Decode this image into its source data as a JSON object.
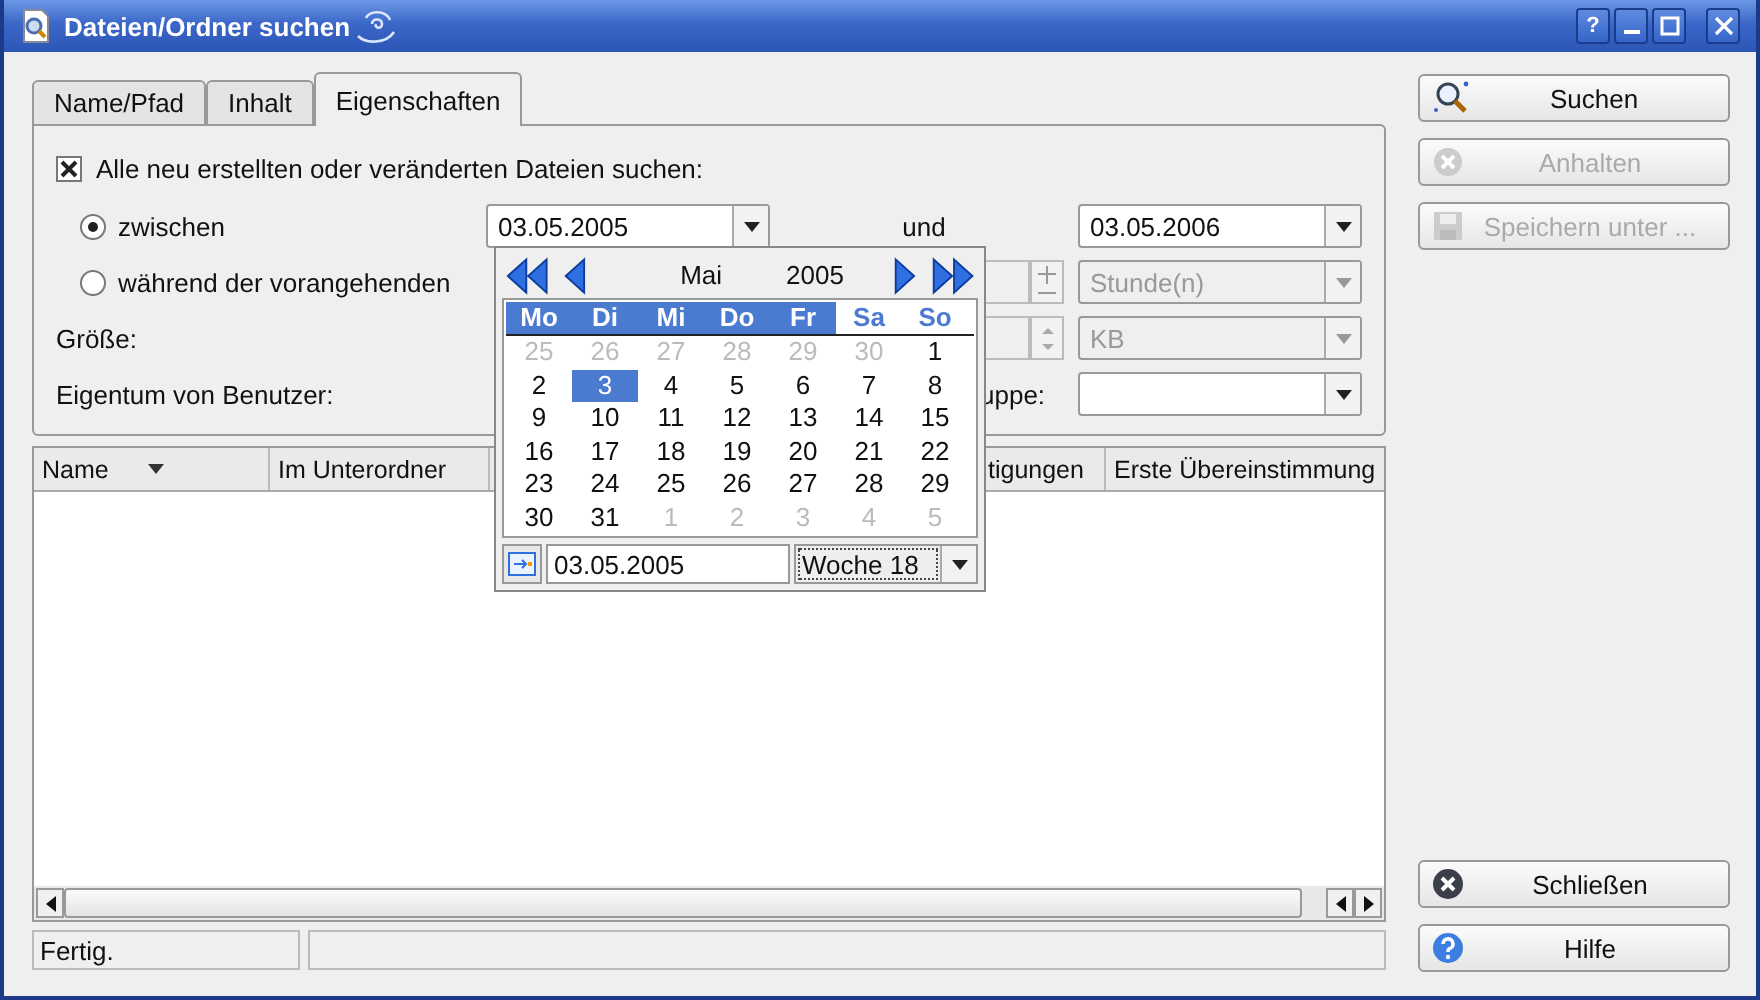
{
  "window": {
    "title": "Dateien/Ordner suchen",
    "help_button": "?"
  },
  "tabs": [
    {
      "label": "Name/Pfad",
      "selected": false
    },
    {
      "label": "Inhalt",
      "selected": false
    },
    {
      "label": "Eigenschaften",
      "selected": true
    }
  ],
  "properties": {
    "checkbox": {
      "label": "Alle neu erstellten oder veränderten Dateien suchen:",
      "checked": true
    },
    "radios": [
      {
        "label": "zwischen",
        "selected": true
      },
      {
        "label": "während der vorangehenden",
        "selected": false
      }
    ],
    "from_date": "03.05.2005",
    "conjunction": "und",
    "to_date": "03.05.2006",
    "period_unit": {
      "value": "Stunde(n)",
      "disabled": true
    },
    "size_label": "Größe:",
    "size_unit": {
      "value": "KB",
      "disabled": true
    },
    "owner_label": "Eigentum von Benutzer:",
    "group_label": "uppe:"
  },
  "table": {
    "columns": [
      {
        "label": "Name",
        "sorted": true
      },
      {
        "label": "Im Unterordner",
        "sorted": false
      },
      {
        "label": "tigungen",
        "sorted": false
      },
      {
        "label": "Erste Übereinstimmung",
        "sorted": false
      }
    ]
  },
  "status_bar": {
    "message": "Fertig."
  },
  "buttons": [
    {
      "label": "Suchen",
      "disabled": false,
      "kind": "search"
    },
    {
      "label": "Anhalten",
      "disabled": true,
      "kind": "stop"
    },
    {
      "label": "Speichern unter ...",
      "disabled": true,
      "kind": "save"
    }
  ],
  "bottom_buttons": [
    {
      "label": "Schließen",
      "kind": "close"
    },
    {
      "label": "Hilfe",
      "kind": "help"
    }
  ],
  "calendar": {
    "month": "Mai",
    "year": "2005",
    "weekdays": [
      {
        "label": "Mo",
        "weekend": false
      },
      {
        "label": "Di",
        "weekend": false
      },
      {
        "label": "Mi",
        "weekend": false
      },
      {
        "label": "Do",
        "weekend": false
      },
      {
        "label": "Fr",
        "weekend": false
      },
      {
        "label": "Sa",
        "weekend": true
      },
      {
        "label": "So",
        "weekend": true
      }
    ],
    "weeks": [
      [
        {
          "day": "25",
          "other_month": true,
          "selected": false
        },
        {
          "day": "26",
          "other_month": true,
          "selected": false
        },
        {
          "day": "27",
          "other_month": true,
          "selected": false
        },
        {
          "day": "28",
          "other_month": true,
          "selected": false
        },
        {
          "day": "29",
          "other_month": true,
          "selected": false
        },
        {
          "day": "30",
          "other_month": true,
          "selected": false
        },
        {
          "day": "1",
          "other_month": false,
          "selected": false
        }
      ],
      [
        {
          "day": "2",
          "other_month": false,
          "selected": false
        },
        {
          "day": "3",
          "other_month": false,
          "selected": true
        },
        {
          "day": "4",
          "other_month": false,
          "selected": false
        },
        {
          "day": "5",
          "other_month": false,
          "selected": false
        },
        {
          "day": "6",
          "other_month": false,
          "selected": false
        },
        {
          "day": "7",
          "other_month": false,
          "selected": false
        },
        {
          "day": "8",
          "other_month": false,
          "selected": false
        }
      ],
      [
        {
          "day": "9",
          "other_month": false,
          "selected": false
        },
        {
          "day": "10",
          "other_month": false,
          "selected": false
        },
        {
          "day": "11",
          "other_month": false,
          "selected": false
        },
        {
          "day": "12",
          "other_month": false,
          "selected": false
        },
        {
          "day": "13",
          "other_month": false,
          "selected": false
        },
        {
          "day": "14",
          "other_month": false,
          "selected": false
        },
        {
          "day": "15",
          "other_month": false,
          "selected": false
        }
      ],
      [
        {
          "day": "16",
          "other_month": false,
          "selected": false
        },
        {
          "day": "17",
          "other_month": false,
          "selected": false
        },
        {
          "day": "18",
          "other_month": false,
          "selected": false
        },
        {
          "day": "19",
          "other_month": false,
          "selected": false
        },
        {
          "day": "20",
          "other_month": false,
          "selected": false
        },
        {
          "day": "21",
          "other_month": false,
          "selected": false
        },
        {
          "day": "22",
          "other_month": false,
          "selected": false
        }
      ],
      [
        {
          "day": "23",
          "other_month": false,
          "selected": false
        },
        {
          "day": "24",
          "other_month": false,
          "selected": false
        },
        {
          "day": "25",
          "other_month": false,
          "selected": false
        },
        {
          "day": "26",
          "other_month": false,
          "selected": false
        },
        {
          "day": "27",
          "other_month": false,
          "selected": false
        },
        {
          "day": "28",
          "other_month": false,
          "selected": false
        },
        {
          "day": "29",
          "other_month": false,
          "selected": false
        }
      ],
      [
        {
          "day": "30",
          "other_month": false,
          "selected": false
        },
        {
          "day": "31",
          "other_month": false,
          "selected": false
        },
        {
          "day": "1",
          "other_month": true,
          "selected": false
        },
        {
          "day": "2",
          "other_month": true,
          "selected": false
        },
        {
          "day": "3",
          "other_month": true,
          "selected": false
        },
        {
          "day": "4",
          "other_month": true,
          "selected": false
        },
        {
          "day": "5",
          "other_month": true,
          "selected": false
        }
      ]
    ],
    "date_field": "03.05.2005",
    "week": "Woche 18"
  }
}
